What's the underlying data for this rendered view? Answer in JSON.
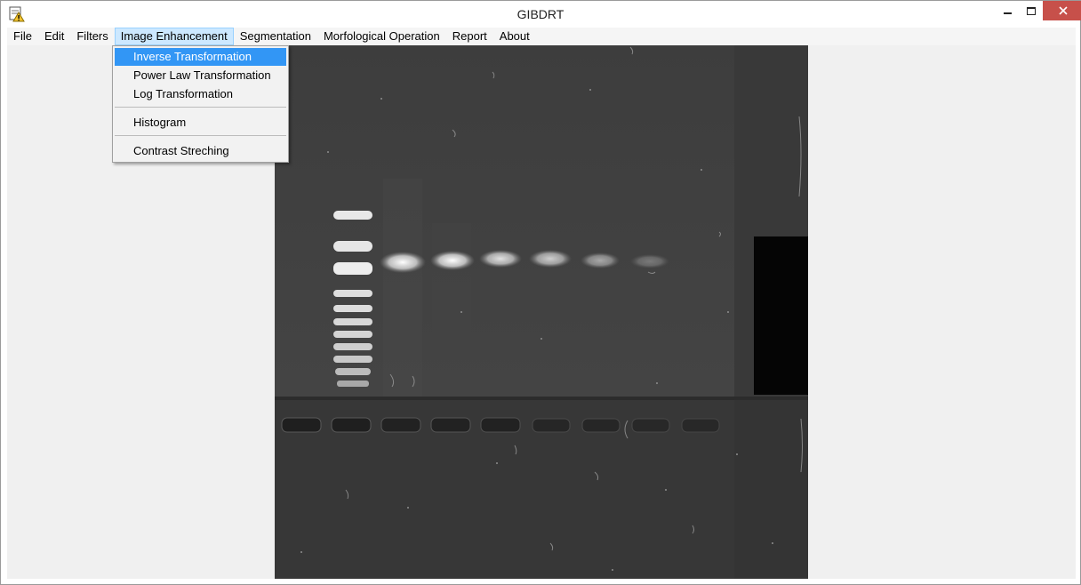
{
  "window": {
    "title": "GIBDRT",
    "accent_close": "#c7504a"
  },
  "menubar": {
    "items": [
      "File",
      "Edit",
      "Filters",
      "Image Enhancement",
      "Segmentation",
      "Morfological Operation",
      "Report",
      "About"
    ],
    "open_menu": "Image Enhancement"
  },
  "dropdown": {
    "items": [
      "Inverse Transformation",
      "Power Law Transformation",
      "Log Transformation",
      "Histogram",
      "Contrast Streching"
    ],
    "highlighted": "Inverse Transformation",
    "highlight_color": "#3296f5"
  },
  "icons": {
    "app": "app-warning-icon",
    "minimize": "minimize-icon",
    "maximize": "maximize-icon",
    "close": "close-icon"
  },
  "colors": {
    "gel_background": "#3a3a3a",
    "client_background": "#f0f0f0"
  }
}
